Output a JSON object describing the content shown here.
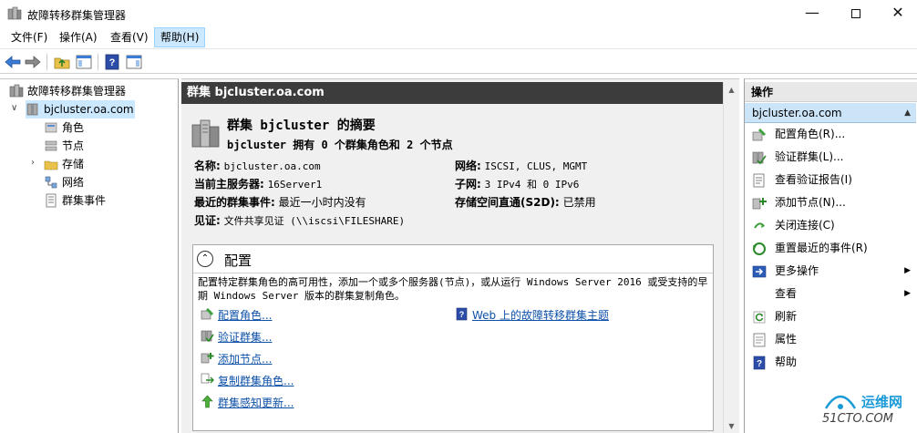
{
  "window": {
    "title": "故障转移群集管理器",
    "minimize": "—",
    "close": "✕"
  },
  "menu": [
    "文件(F)",
    "操作(A)",
    "查看(V)",
    "帮助(H)"
  ],
  "tree": {
    "root": "故障转移群集管理器",
    "cluster": "bjcluster.oa.com",
    "children": [
      "角色",
      "节点",
      "存储",
      "网络",
      "群集事件"
    ]
  },
  "main": {
    "header": "群集 bjcluster.oa.com",
    "summary_title": "群集 bjcluster 的摘要",
    "summary_sub": "bjcluster 拥有 0 个群集角色和 2 个节点",
    "fields": {
      "name_label": "名称:",
      "name_value": "bjcluster.oa.com",
      "server_label": "当前主服务器:",
      "server_value": "16Server1",
      "events_label": "最近的群集事件:",
      "events_value": "最近一小时内没有",
      "witness_label": "见证:",
      "witness_value": "文件共享见证 (\\\\iscsi\\FILESHARE)",
      "network_label": "网络:",
      "network_value": "ISCSI, CLUS, MGMT",
      "subnet_label": "子网:",
      "subnet_value": "3 IPv4 和 0 IPv6",
      "s2d_label": "存储空间直通(S2D):",
      "s2d_value": "已禁用"
    },
    "config": {
      "title": "配置",
      "collapse": "⌃",
      "desc": "配置特定群集角色的高可用性，添加一个或多个服务器(节点)，或从运行 Windows Server 2016 或受支持的早期 Windows Server 版本的群集复制角色。",
      "links": [
        "配置角色...",
        "验证群集...",
        "添加节点...",
        "复制群集角色...",
        "群集感知更新..."
      ],
      "help_link": "Web 上的故障转移群集主题"
    }
  },
  "actions": {
    "header": "操作",
    "group": "bjcluster.oa.com",
    "items": [
      "配置角色(R)...",
      "验证群集(L)...",
      "查看验证报告(I)",
      "添加节点(N)...",
      "关闭连接(C)",
      "重置最近的事件(R)",
      "更多操作",
      "查看",
      "刷新",
      "属性",
      "帮助"
    ]
  },
  "watermark": {
    "cn": "运维网",
    "en": "51CTO.COM"
  }
}
